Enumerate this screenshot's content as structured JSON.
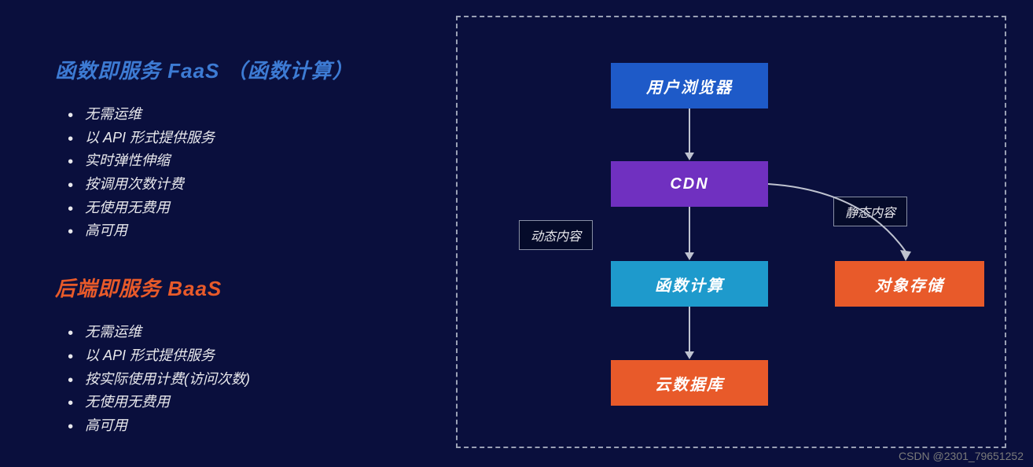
{
  "left": {
    "faas_heading": "函数即服务 FaaS （函数计算）",
    "faas_bullets": [
      "无需运维",
      "以 API 形式提供服务",
      "实时弹性伸缩",
      "按调用次数计费",
      "无使用无费用",
      "高可用"
    ],
    "baas_heading": "后端即服务 BaaS",
    "baas_bullets": [
      "无需运维",
      "以 API 形式提供服务",
      "按实际使用计费(访问次数)",
      "无使用无费用",
      "高可用"
    ]
  },
  "diagram": {
    "nodes": {
      "browser": "用户浏览器",
      "cdn": "CDN",
      "func": "函数计算",
      "db": "云数据库",
      "storage": "对象存储"
    },
    "edge_labels": {
      "dynamic": "动态内容",
      "static": "静态内容"
    },
    "edges": [
      {
        "from": "browser",
        "to": "cdn"
      },
      {
        "from": "cdn",
        "to": "func",
        "label": "动态内容"
      },
      {
        "from": "cdn",
        "to": "storage",
        "label": "静态内容"
      },
      {
        "from": "func",
        "to": "db"
      }
    ]
  },
  "watermark": "CSDN @2301_79651252"
}
